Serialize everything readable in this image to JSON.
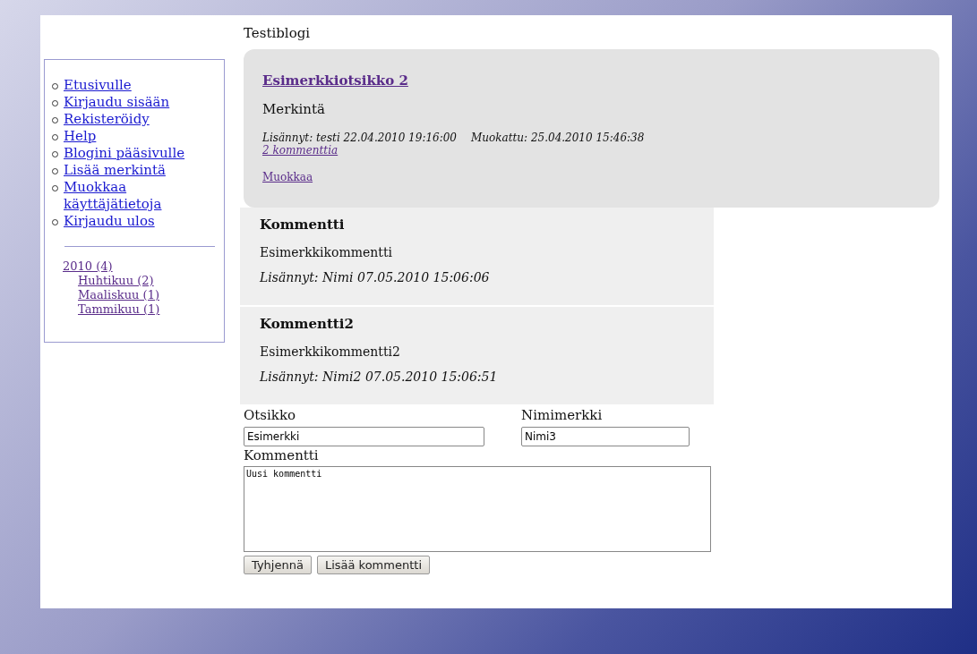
{
  "blog_title": "Testiblogi",
  "nav": [
    "Etusivulle",
    "Kirjaudu sisään",
    "Rekisteröidy",
    "Help",
    "Blogini pääsivulle",
    "Lisää merkintä",
    "Muokkaa käyttäjätietoja",
    "Kirjaudu ulos"
  ],
  "archive": [
    {
      "label": "2010 (4)",
      "children": [
        {
          "label": "Huhtikuu (2)"
        },
        {
          "label": "Maaliskuu (1)"
        },
        {
          "label": "Tammikuu (1)"
        }
      ]
    }
  ],
  "post": {
    "title": "Esimerkkiotsikko 2",
    "body": "Merkintä",
    "added": "Lisännyt: testi 22.04.2010 19:16:00",
    "modified": "Muokattu: 25.04.2010 15:46:38",
    "comments_link": "2 kommenttia",
    "edit_link": "Muokkaa"
  },
  "comments": [
    {
      "title": "Kommentti",
      "body": "Esimerkkikommentti",
      "meta": "Lisännyt: Nimi 07.05.2010 15:06:06"
    },
    {
      "title": "Kommentti2",
      "body": "Esimerkkikommentti2",
      "meta": "Lisännyt: Nimi2 07.05.2010 15:06:51"
    }
  ],
  "form": {
    "title_label": "Otsikko",
    "title_value": "Esimerkki",
    "nick_label": "Nimimerkki",
    "nick_value": "Nimi3",
    "comment_label": "Kommentti",
    "comment_value": "Uusi kommentti",
    "buttons": [
      "Tyhjennä",
      "Lisää kommentti"
    ]
  }
}
